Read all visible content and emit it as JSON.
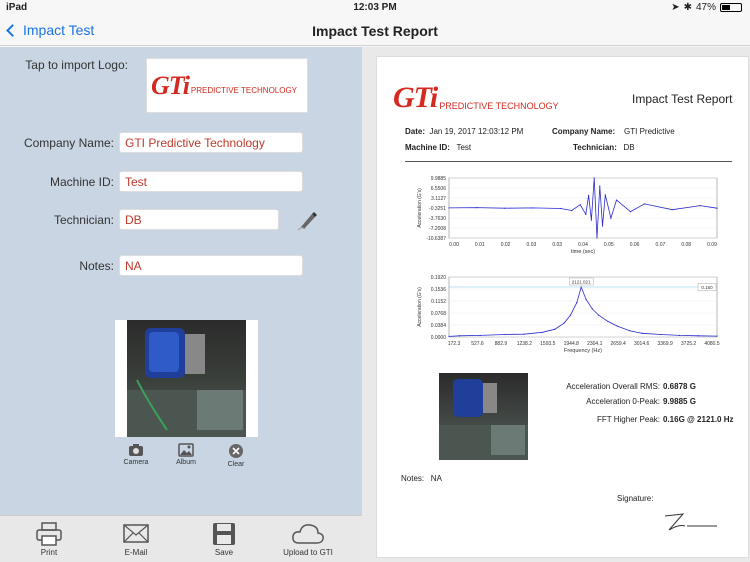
{
  "status": {
    "device": "iPad",
    "time": "12:03 PM",
    "battery": "47%",
    "battery_level": 0.47
  },
  "nav": {
    "back_label": "Impact Test",
    "title": "Impact Test Report"
  },
  "form": {
    "logo_label": "Tap to import Logo:",
    "company_label": "Company Name:",
    "company_value": "GTI Predictive Technology",
    "machine_label": "Machine ID:",
    "machine_value": "Test",
    "technician_label": "Technician:",
    "technician_value": "DB",
    "notes_label": "Notes:",
    "notes_value": "NA"
  },
  "logo": {
    "mark": "GTi",
    "sub": "PREDICTIVE TECHNOLOGY"
  },
  "photo_buttons": {
    "camera": "Camera",
    "album": "Album",
    "clear": "Clear"
  },
  "toolbar": {
    "print": "Print",
    "email": "E-Mail",
    "save": "Save",
    "upload": "Upload to GTI"
  },
  "report": {
    "title": "Impact Test Report",
    "date_label": "Date:",
    "date_value": "Jan 19, 2017  12:03:12 PM",
    "company_label": "Company Name:",
    "company_value": "GTI Predictive",
    "machine_label": "Machine ID:",
    "machine_value": "Test",
    "technician_label": "Technician:",
    "technician_value": "DB",
    "rms_label": "Acceleration Overall RMS:",
    "rms_value": "0.6878 G",
    "peak_label": "Acceleration 0-Peak:",
    "peak_value": "9.9885 G",
    "fft_label": "FFT Higher Peak:",
    "fft_value": "0.16G @ 2121.0 Hz",
    "notes_label": "Notes:",
    "notes_value": "NA",
    "signature_label": "Signature:"
  },
  "chart_data": [
    {
      "type": "line",
      "xlabel": "time (sec)",
      "ylabel": "Acceleration (G's)",
      "x_ticks": [
        "0.00",
        "0.01",
        "0.02",
        "0.03",
        "0.03",
        "0.04",
        "0.05",
        "0.06",
        "0.07",
        "0.08",
        "0.09"
      ],
      "y_ticks": [
        "9.9885",
        "6.5506",
        "3.1127",
        "-0.3251",
        "-3.7630",
        "-7.2008",
        "-10.6387"
      ],
      "ylim": [
        -10.6387,
        9.9885
      ],
      "xlim": [
        0,
        0.096
      ],
      "series": [
        {
          "x": [
            0.0,
            0.01,
            0.02,
            0.03,
            0.04,
            0.044,
            0.047,
            0.049,
            0.05,
            0.051,
            0.052,
            0.053,
            0.054,
            0.055,
            0.056,
            0.058,
            0.06,
            0.065,
            0.07,
            0.08,
            0.09,
            0.096
          ],
          "y": [
            -0.3,
            -0.2,
            -0.4,
            -0.3,
            -0.5,
            -1.2,
            0.8,
            -2.5,
            4.0,
            -4.5,
            9.99,
            -10.64,
            7.2,
            -6.5,
            4.2,
            -3.8,
            2.4,
            -1.6,
            1.1,
            -0.9,
            0.5,
            -0.4
          ]
        }
      ]
    },
    {
      "type": "line",
      "xlabel": "Frequency (Hz)",
      "ylabel": "Acceleration (G's)",
      "x_ticks": [
        "172.3",
        "527.6",
        "882.9",
        "1238.2",
        "1593.5",
        "1944.8",
        "2304.1",
        "2659.4",
        "3014.6",
        "3369.9",
        "3725.2",
        "4080.5"
      ],
      "y_ticks": [
        "0.1920",
        "0.1536",
        "0.1152",
        "0.0768",
        "0.0384",
        "0.0000"
      ],
      "ylim": [
        0,
        0.192
      ],
      "xlim": [
        0,
        4300
      ],
      "annotations": [
        "2121.021",
        "0.160"
      ],
      "series": [
        {
          "x": [
            0,
            172,
            500,
            900,
            1200,
            1500,
            1700,
            1850,
            1950,
            2050,
            2121,
            2200,
            2300,
            2400,
            2550,
            2700,
            2900,
            3100,
            3400,
            3700,
            4000,
            4300
          ],
          "y": [
            0.002,
            0.004,
            0.005,
            0.008,
            0.009,
            0.015,
            0.025,
            0.045,
            0.07,
            0.11,
            0.16,
            0.12,
            0.09,
            0.07,
            0.05,
            0.035,
            0.02,
            0.012,
            0.008,
            0.005,
            0.004,
            0.003
          ]
        }
      ]
    }
  ]
}
